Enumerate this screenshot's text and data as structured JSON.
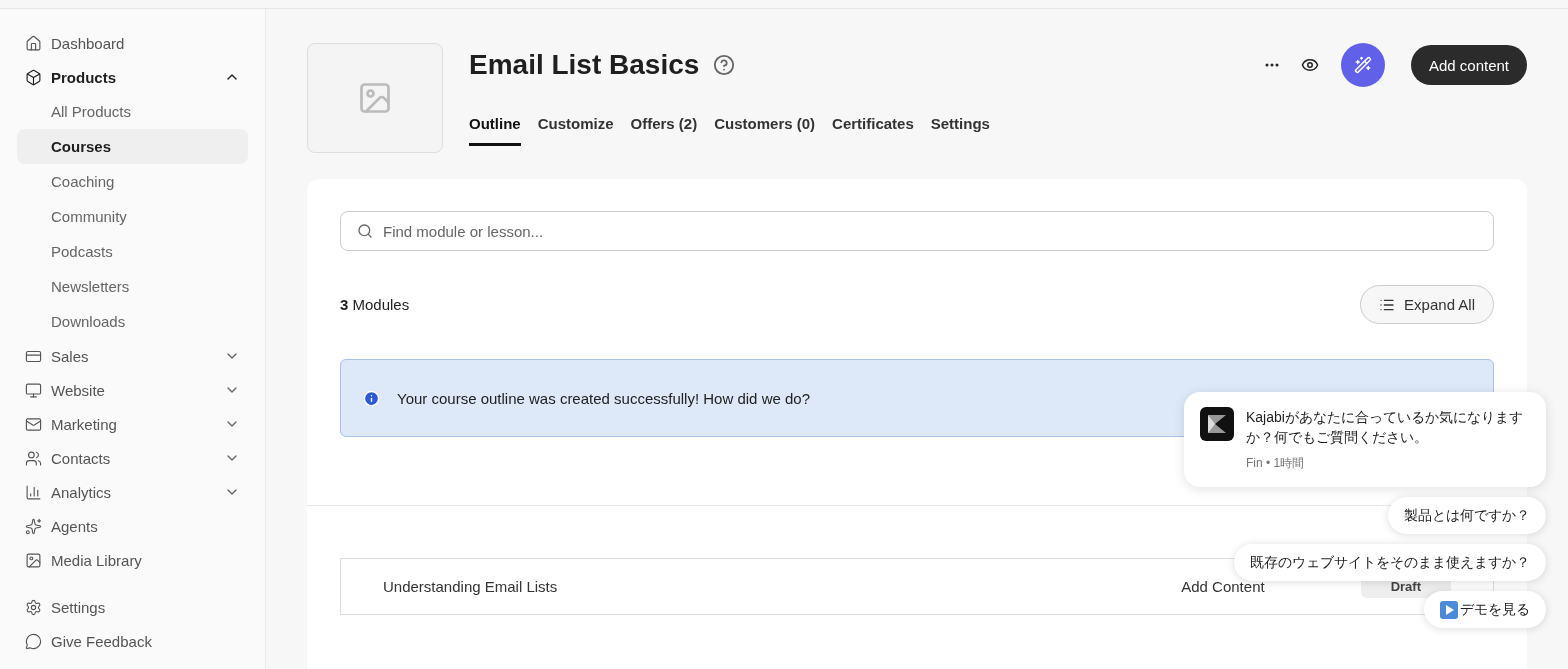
{
  "sidebar": {
    "items": [
      {
        "label": "Dashboard",
        "kind": "home",
        "selected": false
      },
      {
        "label": "Products",
        "kind": "box",
        "selected": true,
        "expanded": true,
        "children": [
          {
            "label": "All Products",
            "selected": false
          },
          {
            "label": "Courses",
            "selected": true
          },
          {
            "label": "Coaching",
            "selected": false
          },
          {
            "label": "Community",
            "selected": false
          },
          {
            "label": "Podcasts",
            "selected": false
          },
          {
            "label": "Newsletters",
            "selected": false
          },
          {
            "label": "Downloads",
            "selected": false
          }
        ]
      },
      {
        "label": "Sales",
        "kind": "card",
        "selected": false,
        "expanded": false
      },
      {
        "label": "Website",
        "kind": "monitor",
        "selected": false,
        "expanded": false
      },
      {
        "label": "Marketing",
        "kind": "mail",
        "selected": false,
        "expanded": false
      },
      {
        "label": "Contacts",
        "kind": "users",
        "selected": false,
        "expanded": false
      },
      {
        "label": "Analytics",
        "kind": "chart",
        "selected": false,
        "expanded": false
      },
      {
        "label": "Agents",
        "kind": "sparkle",
        "selected": false
      },
      {
        "label": "Media Library",
        "kind": "image",
        "selected": false
      }
    ],
    "footer": [
      {
        "label": "Settings",
        "kind": "gear"
      },
      {
        "label": "Give Feedback",
        "kind": "chat"
      }
    ]
  },
  "header": {
    "title": "Email List Basics",
    "primary_button": "Add content",
    "tabs": [
      {
        "label": "Outline",
        "selected": true
      },
      {
        "label": "Customize",
        "selected": false
      },
      {
        "label": "Offers (2)",
        "selected": false
      },
      {
        "label": "Customers (0)",
        "selected": false
      },
      {
        "label": "Certificates",
        "selected": false
      },
      {
        "label": "Settings",
        "selected": false
      }
    ]
  },
  "outline": {
    "search": {
      "placeholder": "Find module or lesson..."
    },
    "module_count": "**3** Modules",
    "expand_button": "Expand All",
    "banner": "Your course outline was created successfully! How did we do?",
    "modules": [
      {
        "title": "Understanding Email Lists",
        "action": "Add Content",
        "status": "Draft"
      }
    ]
  },
  "chat": {
    "message": "Kajabiがあなたに合っているか気になりますか？何でもご質問ください。",
    "meta": "Fin • 1時間",
    "suggestions": [
      {
        "label": "製品とは何ですか？",
        "kind": "text"
      },
      {
        "label": "既存のウェブサイトをそのまま使えますか？",
        "kind": "text"
      },
      {
        "label": "デモを見る",
        "kind": "video"
      }
    ]
  }
}
